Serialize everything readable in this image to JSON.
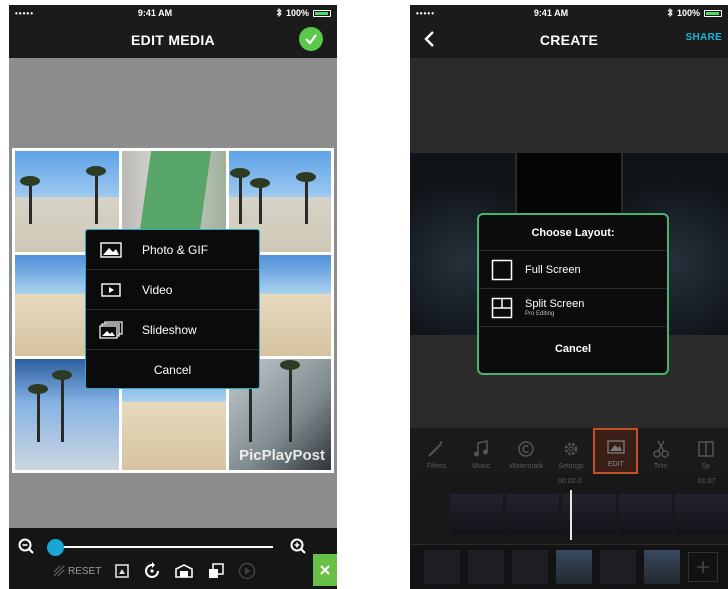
{
  "left": {
    "status": {
      "signal": "•••••",
      "time": "9:41 AM",
      "battery": "100%"
    },
    "title": "EDIT MEDIA",
    "watermark": "PicPlayPost",
    "menu": {
      "items": [
        {
          "label": "Photo & GIF",
          "icon": "photo-icon"
        },
        {
          "label": "Video",
          "icon": "video-icon"
        },
        {
          "label": "Slideshow",
          "icon": "slideshow-icon"
        }
      ],
      "cancel": "Cancel"
    },
    "toolbar": {
      "reset": "RESET"
    }
  },
  "right": {
    "status": {
      "signal": "•••••",
      "time": "9:41 AM",
      "battery": "100%"
    },
    "title": "CREATE",
    "share": "SHARE",
    "dialog": {
      "title": "Choose Layout:",
      "options": [
        {
          "label": "Full Screen",
          "sub": ""
        },
        {
          "label": "Split Screen",
          "sub": "Pro Editing"
        }
      ],
      "cancel": "Cancel"
    },
    "edit_tools": [
      "Filters",
      "Music",
      "Watermark",
      "Settings",
      "EDIT",
      "Trim",
      "Sp"
    ],
    "timeline": {
      "time_mid": "00:02.0",
      "time_right": "01:07"
    }
  },
  "colors": {
    "accent_blue": "#1aa6d4",
    "accent_green": "#5ac84b",
    "dialog_border": "#48b26e",
    "edit_active": "#c4502b"
  }
}
